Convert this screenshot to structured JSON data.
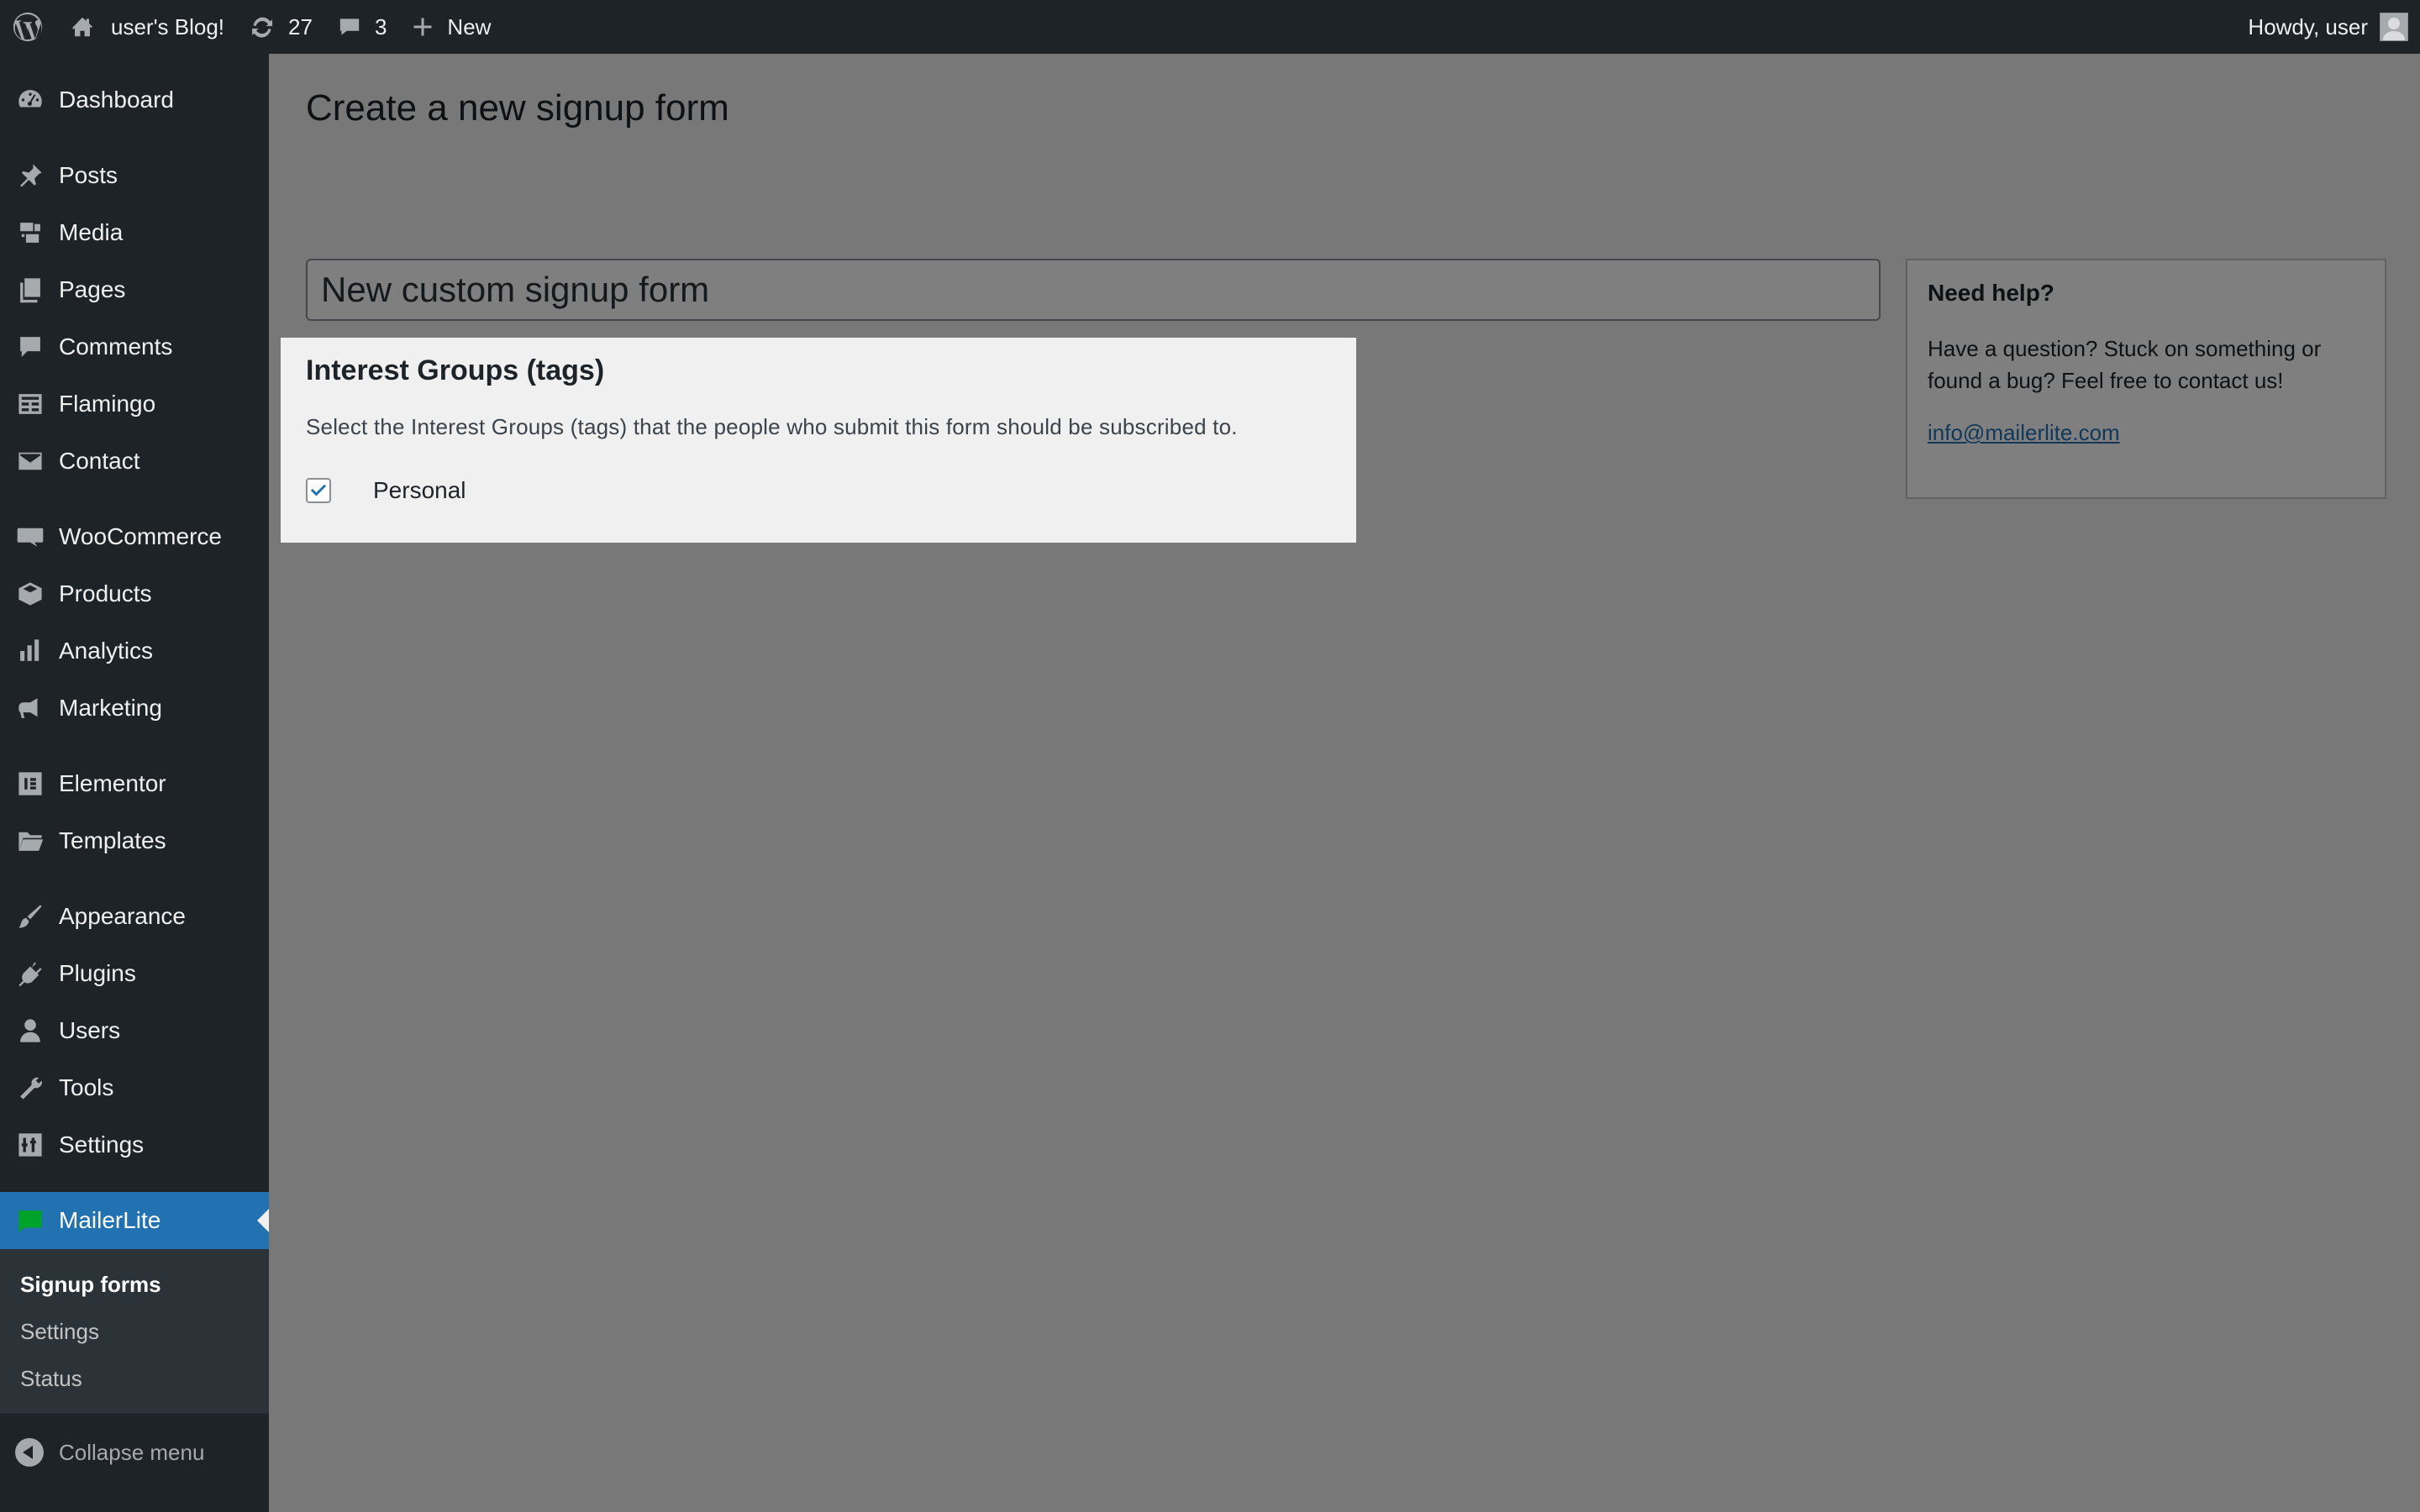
{
  "adminbar": {
    "site_name": "user's Blog!",
    "updates_count": "27",
    "comments_count": "3",
    "new_label": "New",
    "howdy": "Howdy, user"
  },
  "sidebar": {
    "items": [
      {
        "label": "Dashboard",
        "icon": "dashboard-icon"
      },
      {
        "label": "Posts",
        "icon": "pin-icon"
      },
      {
        "label": "Media",
        "icon": "media-icon"
      },
      {
        "label": "Pages",
        "icon": "pages-icon"
      },
      {
        "label": "Comments",
        "icon": "comment-icon"
      },
      {
        "label": "Flamingo",
        "icon": "flamingo-icon"
      },
      {
        "label": "Contact",
        "icon": "mail-icon"
      },
      {
        "label": "WooCommerce",
        "icon": "woo-icon"
      },
      {
        "label": "Products",
        "icon": "box-icon"
      },
      {
        "label": "Analytics",
        "icon": "bar-chart-icon"
      },
      {
        "label": "Marketing",
        "icon": "megaphone-icon"
      },
      {
        "label": "Elementor",
        "icon": "elementor-icon"
      },
      {
        "label": "Templates",
        "icon": "folder-icon"
      },
      {
        "label": "Appearance",
        "icon": "brush-icon"
      },
      {
        "label": "Plugins",
        "icon": "plug-icon"
      },
      {
        "label": "Users",
        "icon": "user-icon"
      },
      {
        "label": "Tools",
        "icon": "wrench-icon"
      },
      {
        "label": "Settings",
        "icon": "sliders-icon"
      },
      {
        "label": "MailerLite",
        "icon": "mailerlite-icon"
      }
    ],
    "submenu": [
      "Signup forms",
      "Settings",
      "Status"
    ],
    "collapse_label": "Collapse menu"
  },
  "main": {
    "page_title": "Create a new signup form",
    "form_title_value": "New custom signup form",
    "panel": {
      "title": "Interest Groups (tags)",
      "description": "Select the Interest Groups (tags) that the people who submit this form should be subscribed to.",
      "checkbox_label": "Personal",
      "checked": true
    },
    "help": {
      "title": "Need help?",
      "text": "Have a question? Stuck on something or found a bug? Feel free to contact us!",
      "email": "info@mailerlite.com"
    }
  },
  "colors": {
    "admin_bg": "#1d2327",
    "accent": "#2271b1",
    "mailerlite_green": "#00a32a",
    "overlay": "rgba(0,0,0,0.5)"
  }
}
